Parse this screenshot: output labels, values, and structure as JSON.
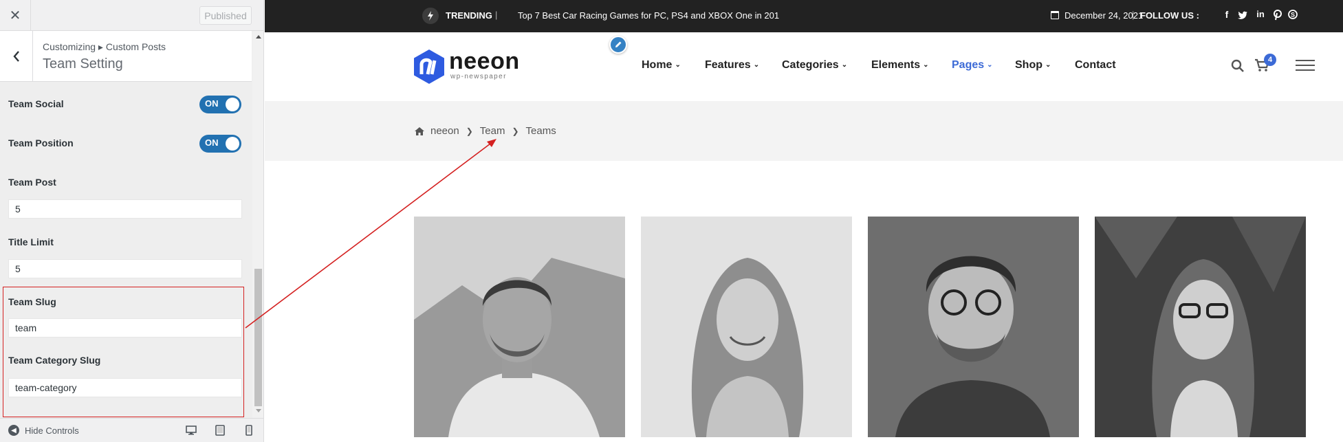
{
  "customizer": {
    "publish_label": "Published",
    "breadcrumb": "Customizing ▸ Custom Posts",
    "title": "Team Setting",
    "controls": {
      "team_social": {
        "label": "Team Social",
        "state": "ON"
      },
      "team_position": {
        "label": "Team Position",
        "state": "ON"
      },
      "team_post": {
        "label": "Team Post",
        "value": "5"
      },
      "title_limit": {
        "label": "Title Limit",
        "value": "5"
      },
      "team_slug": {
        "label": "Team Slug",
        "value": "team"
      },
      "team_category_slug": {
        "label": "Team Category Slug",
        "value": "team-category"
      }
    },
    "footer": {
      "hide_label": "Hide Controls"
    }
  },
  "site": {
    "topbar": {
      "trending_label": "TRENDING",
      "trending_news": "Top 7 Best Car Racing Games for PC, PS4 and XBOX One in 201",
      "date": "December 24, 2021",
      "follow_label": "FOLLOW US :",
      "social_icons": [
        "facebook-icon",
        "twitter-icon",
        "linkedin-icon",
        "pinterest-icon",
        "skype-icon"
      ]
    },
    "logo": {
      "word": "neeon",
      "tagline": "wp-newspaper"
    },
    "nav": [
      {
        "label": "Home",
        "dropdown": true
      },
      {
        "label": "Features",
        "dropdown": true
      },
      {
        "label": "Categories",
        "dropdown": true
      },
      {
        "label": "Elements",
        "dropdown": true
      },
      {
        "label": "Pages",
        "dropdown": true,
        "active": true
      },
      {
        "label": "Shop",
        "dropdown": true
      },
      {
        "label": "Contact",
        "dropdown": false
      }
    ],
    "cart_count": "4",
    "breadcrumb": [
      "neeon",
      "Team",
      "Teams"
    ],
    "accent_color": "#3c6ad6"
  },
  "annotation_color": "#d42020"
}
